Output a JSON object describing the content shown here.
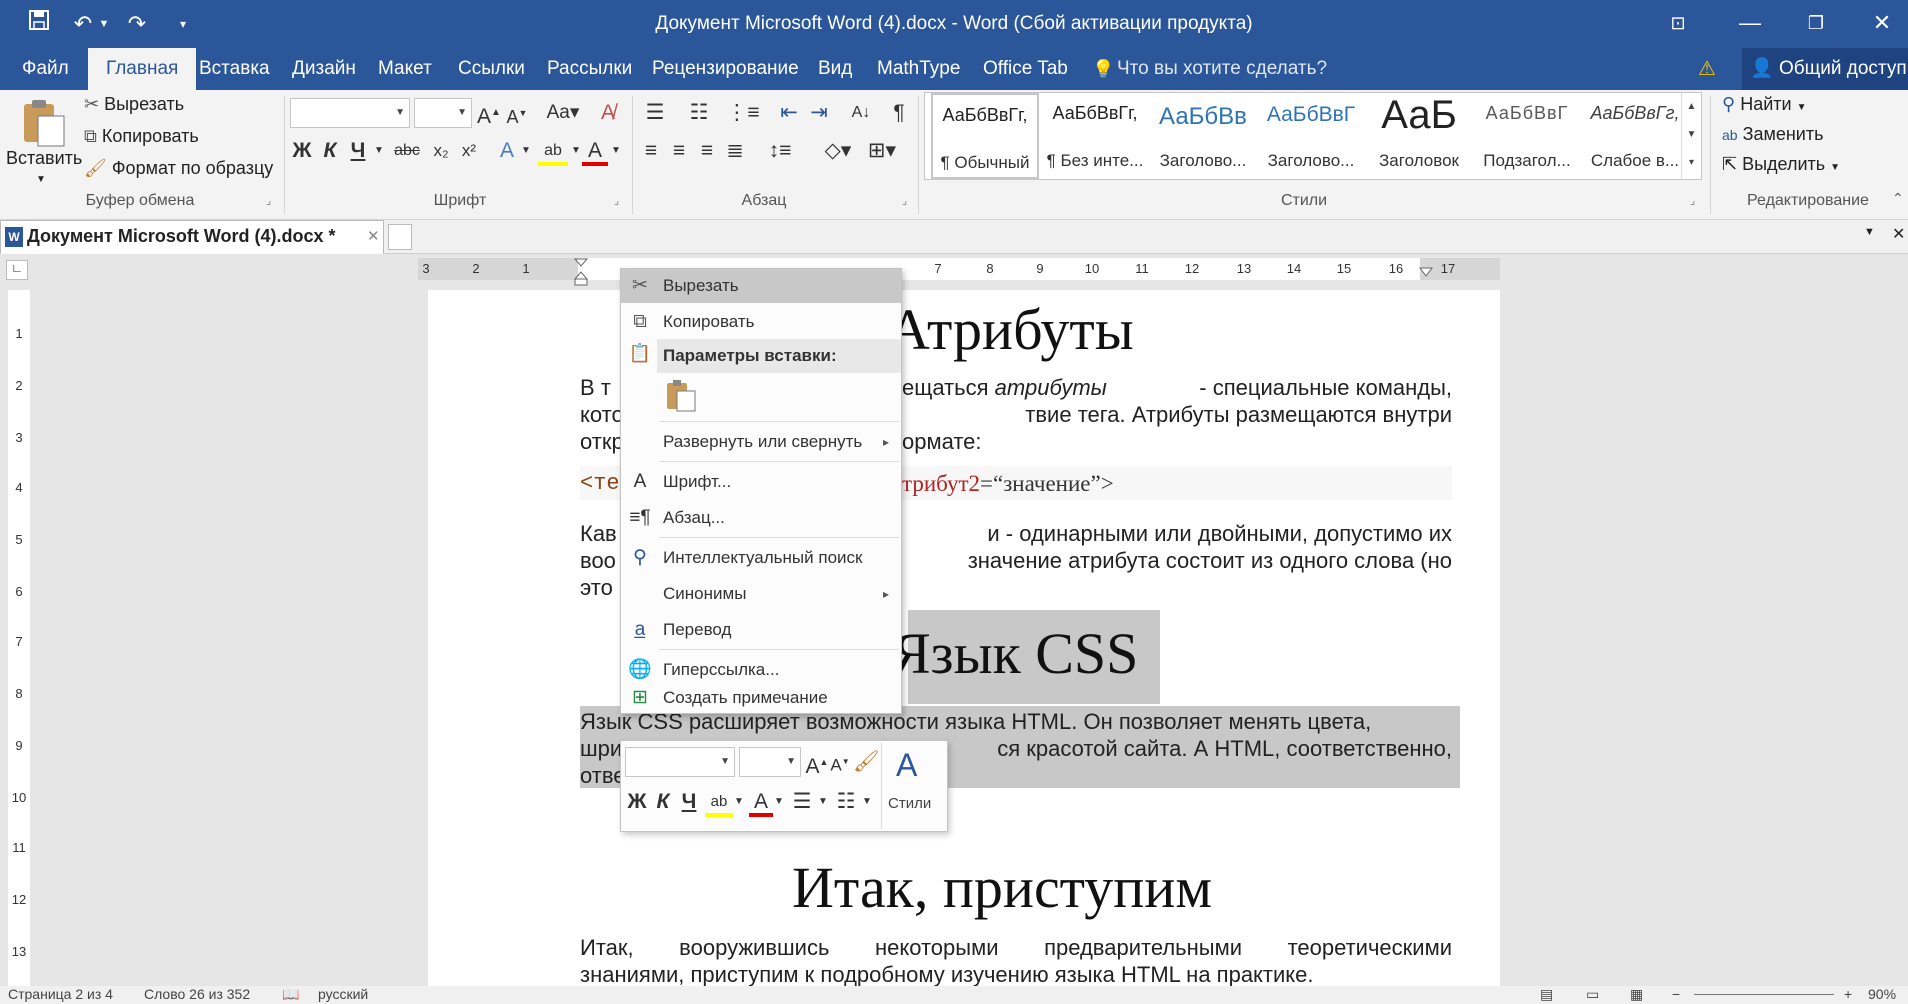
{
  "window": {
    "title": "Документ Microsoft Word (4).docx - Word (Сбой активации продукта)",
    "accent": "#2b579a"
  },
  "quick_access": {
    "save_icon": "save-icon",
    "undo_icon": "undo-icon",
    "redo_icon": "redo-icon"
  },
  "tabs": [
    {
      "label": "Файл"
    },
    {
      "label": "Главная"
    },
    {
      "label": "Вставка"
    },
    {
      "label": "Дизайн"
    },
    {
      "label": "Макет"
    },
    {
      "label": "Ссылки"
    },
    {
      "label": "Рассылки"
    },
    {
      "label": "Рецензирование"
    },
    {
      "label": "Вид"
    },
    {
      "label": "MathType"
    },
    {
      "label": "Office Tab"
    }
  ],
  "active_tab": "Главная",
  "tell_me": "Что вы хотите сделать?",
  "share": "Общий доступ",
  "ribbon": {
    "clipboard": {
      "paste": "Вставить",
      "cut": "Вырезать",
      "copy": "Копировать",
      "format_painter": "Формат по образцу",
      "group": "Буфер обмена"
    },
    "font": {
      "group": "Шрифт",
      "bold": "Ж",
      "italic": "К",
      "underline": "Ч",
      "strike": "abc",
      "subscript": "x₂",
      "superscript": "x²",
      "change_case": "Aa"
    },
    "paragraph": {
      "group": "Абзац"
    },
    "styles": {
      "group": "Стили",
      "items": [
        {
          "sample": "АаБбВвГг,",
          "name": "¶ Обычный"
        },
        {
          "sample": "АаБбВвГг,",
          "name": "¶ Без инте..."
        },
        {
          "sample": "АаБбВв",
          "name": "Заголово..."
        },
        {
          "sample": "АаБбВвГ",
          "name": "Заголово..."
        },
        {
          "sample": "АаБ",
          "name": "Заголовок"
        },
        {
          "sample": "АаБбВвГ",
          "name": "Подзагол..."
        },
        {
          "sample": "АаБбВвГг,",
          "name": "Слабое в..."
        }
      ]
    },
    "editing": {
      "group": "Редактирование",
      "find": "Найти",
      "replace": "Заменить",
      "select": "Выделить"
    }
  },
  "doc_tab": {
    "label": "Документ Microsoft Word (4).docx *"
  },
  "document": {
    "heading1": "Атрибуты",
    "p1_line1": "В т",
    "p1_mid1": "ещаться",
    "p1_italic": "атрибуты",
    "p1_rest1": "-  специальные команды,",
    "p1_line2a": "кото",
    "p1_line2b": "твие тега. Атрибуты размещаются внутри",
    "p1_line3a": "откр",
    "p1_line3b": "ормате:",
    "code_a": "<те",
    "code_b": "трибут2",
    "code_c": "=“значение”>",
    "p2_line1a": "Кав",
    "p2_line1b": "и - одинарными или двойными, допустимо их",
    "p2_line2a": "воо",
    "p2_line2b": "значение атрибута состоит из одного слова (но",
    "p2_line3a": "это",
    "heading2": "Язык CSS",
    "p3_line1": "Язык CSS расширяет возможности языка HTML. Он позволяет менять цвета,",
    "p3_line2a": "шри",
    "p3_line2b": "ся красотой сайта. А HTML, соответственно,",
    "p3_line3a": "отве",
    "heading3": "Итак, приступим",
    "p4_line1": "Итак, вооружившись некоторыми предварительными теоретическими",
    "p4_line2": "знаниями, приступим к подробному изучению языка HTML на практике."
  },
  "context_menu": {
    "cut": "Вырезать",
    "copy": "Копировать",
    "paste_header": "Параметры вставки:",
    "expand": "Развернуть или свернуть",
    "font": "Шрифт...",
    "paragraph": "Абзац...",
    "smart_lookup": "Интеллектуальный поиск",
    "synonyms": "Синонимы",
    "translate": "Перевод",
    "hyperlink": "Гиперссылка...",
    "comment": "Создать примечание"
  },
  "mini_toolbar": {
    "bold": "Ж",
    "italic": "К",
    "underline": "Ч",
    "styles": "Стили"
  },
  "status": {
    "page": "Страница 2 из 4",
    "words": "Слово 26 из 352",
    "language": "русский",
    "zoom": "90%"
  }
}
